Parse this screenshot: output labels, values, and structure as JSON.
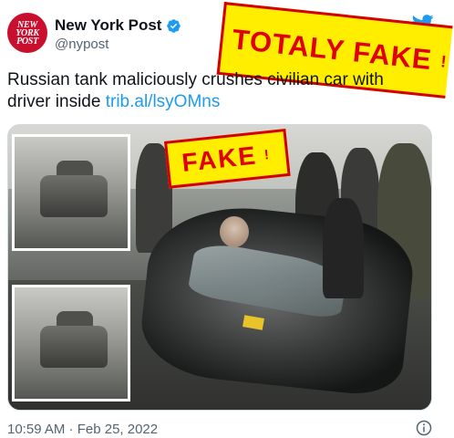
{
  "tweet": {
    "avatar_text": "NEW\nYORK\nPOST",
    "display_name": "New York Post",
    "handle": "@nypost",
    "text": "Russian tank maliciously crushes civilian car with driver inside ",
    "link": "trib.al/lsyOMns",
    "timestamp": "10:59 AM · Feb 25, 2022"
  },
  "stamps": {
    "big_label": "TOTALY FAKE",
    "big_mark": "!",
    "small_label": "FAKE",
    "small_mark": "!"
  },
  "icons": {
    "verified": "verified-badge-icon",
    "brand": "twitter-bird-icon",
    "info": "info-icon"
  },
  "colors": {
    "brand_blue": "#1d9bf0",
    "stamp_yellow": "#ffee00",
    "stamp_red": "#e00000",
    "avatar_red": "#c8102e"
  }
}
